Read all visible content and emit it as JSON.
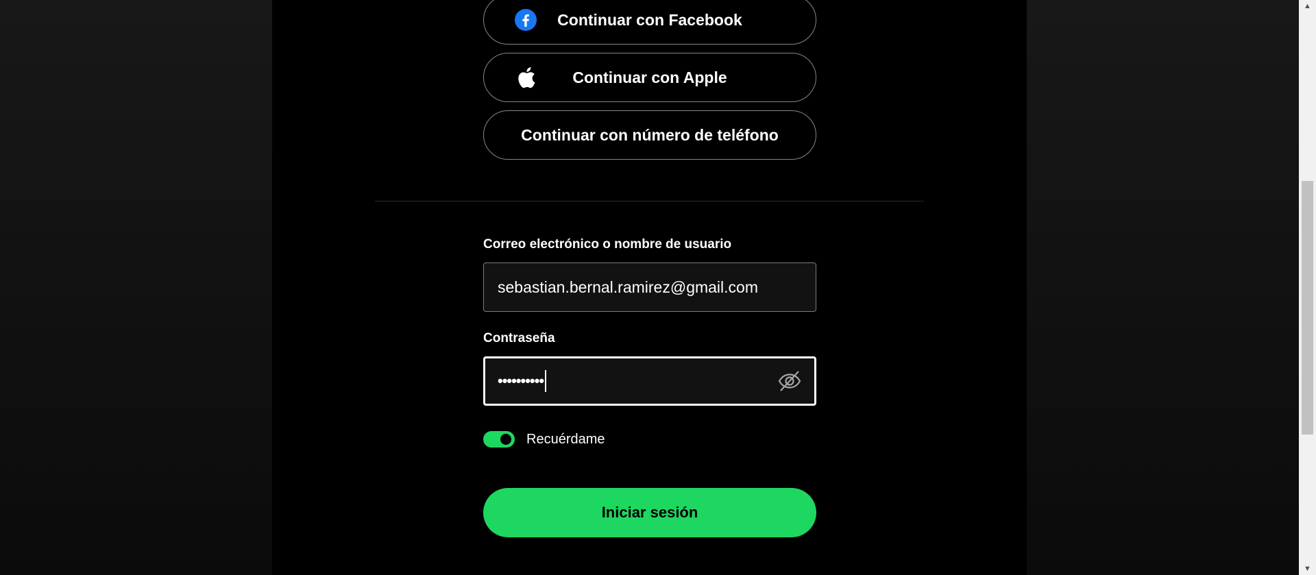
{
  "oauth": {
    "facebook_label": "Continuar con Facebook",
    "apple_label": "Continuar con Apple",
    "phone_label": "Continuar con número de teléfono"
  },
  "email": {
    "label": "Correo electrónico o nombre de usuario",
    "value": "sebastian.bernal.ramirez@gmail.com"
  },
  "password": {
    "label": "Contraseña",
    "masked_value": "••••••••••",
    "visibility_icon": "eye-slash-icon"
  },
  "remember": {
    "label": "Recuérdame",
    "enabled": true
  },
  "submit": {
    "label": "Iniciar sesión"
  },
  "colors": {
    "accent": "#1ed760",
    "background": "#000000",
    "facebook_blue": "#1877f2"
  },
  "icons": {
    "facebook": "facebook-icon",
    "apple": "apple-icon"
  }
}
